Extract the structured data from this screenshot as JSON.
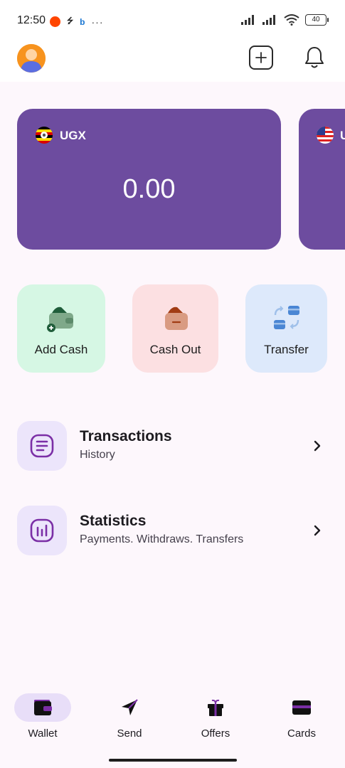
{
  "status_bar": {
    "time": "12:50",
    "indicator_small": "⭍",
    "indicator_b": "b",
    "more": "···",
    "battery": "40"
  },
  "cards": [
    {
      "currency_code": "UGX",
      "flag": "uganda-flag",
      "balance": "0.00"
    },
    {
      "currency_code": "U",
      "flag": "usa-flag"
    }
  ],
  "actions": [
    {
      "label": "Add Cash",
      "icon": "wallet-add-icon",
      "bg": "#d6f7e4"
    },
    {
      "label": "Cash Out",
      "icon": "wallet-minus-icon",
      "bg": "#fce0e2"
    },
    {
      "label": "Transfer",
      "icon": "transfer-icon",
      "bg": "#dde9fb"
    }
  ],
  "menu": [
    {
      "title": "Transactions",
      "subtitle": "History",
      "icon": "list-icon"
    },
    {
      "title": "Statistics",
      "subtitle": "Payments. Withdraws. Transfers",
      "icon": "chart-icon"
    }
  ],
  "bottom_nav": [
    {
      "label": "Wallet",
      "icon": "wallet-icon",
      "active": true
    },
    {
      "label": "Send",
      "icon": "send-icon",
      "active": false
    },
    {
      "label": "Offers",
      "icon": "gift-icon",
      "active": false
    },
    {
      "label": "Cards",
      "icon": "card-icon",
      "active": false
    }
  ],
  "colors": {
    "card_purple": "#6d4c9f",
    "accent_purple": "#7b2fa6",
    "active_pill": "#e8def8",
    "background": "#fdf7fc"
  }
}
